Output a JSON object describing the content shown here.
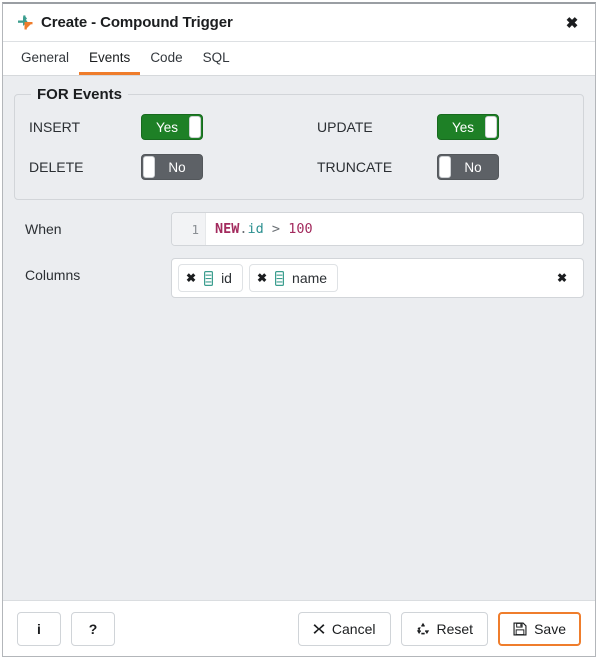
{
  "window": {
    "title": "Create - Compound Trigger",
    "icon": "compound-trigger-icon",
    "close_label": "✖"
  },
  "tabs": [
    {
      "label": "General",
      "active": false
    },
    {
      "label": "Events",
      "active": true
    },
    {
      "label": "Code",
      "active": false
    },
    {
      "label": "SQL",
      "active": false
    }
  ],
  "for_events": {
    "legend": "FOR Events",
    "toggles": [
      {
        "label": "INSERT",
        "value": "Yes",
        "state": "on"
      },
      {
        "label": "UPDATE",
        "value": "Yes",
        "state": "on"
      },
      {
        "label": "DELETE",
        "value": "No",
        "state": "off"
      },
      {
        "label": "TRUNCATE",
        "value": "No",
        "state": "off"
      }
    ]
  },
  "when": {
    "label": "When",
    "line_number": "1",
    "code": "NEW.id > 100",
    "tokens": {
      "keyword": "NEW",
      "dot": ".",
      "property": "id",
      "operator": " > ",
      "number": "100"
    }
  },
  "columns": {
    "label": "Columns",
    "tags": [
      {
        "name": "id",
        "remove_label": "✖",
        "icon": "column-icon"
      },
      {
        "name": "name",
        "remove_label": "✖",
        "icon": "column-icon"
      }
    ],
    "clear_all_label": "✖"
  },
  "footer": {
    "info_label": "i",
    "help_label": "?",
    "cancel_label": "Cancel",
    "reset_label": "Reset",
    "save_label": "Save"
  },
  "colors": {
    "accent_orange": "#ef7d2c",
    "toggle_on_green": "#1e8026",
    "toggle_off_gray": "#5d6166",
    "body_background": "#ebedf0",
    "code_keyword": "#a32b5e",
    "code_property": "#2a8f8f",
    "column_icon": "#3c9e8f"
  }
}
